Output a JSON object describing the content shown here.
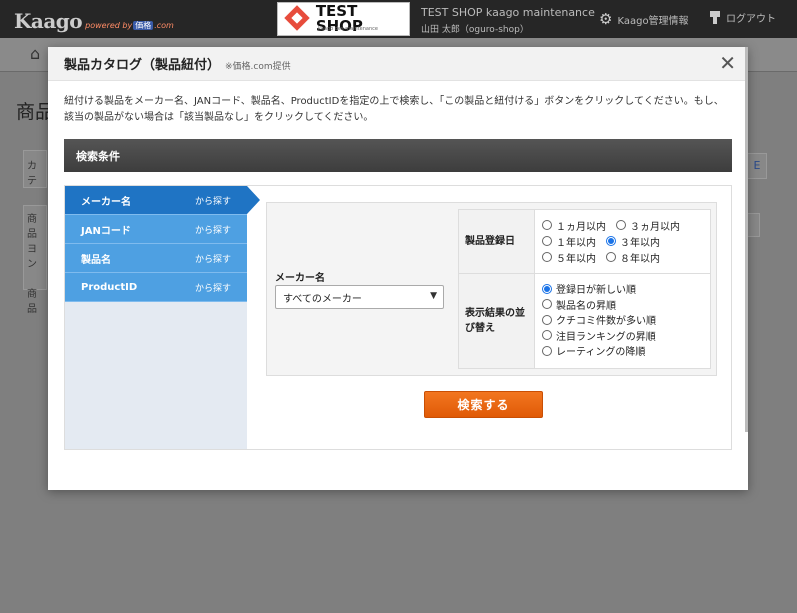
{
  "header": {
    "logo_text": "Kaago",
    "logo_sub_prefix": "powered by",
    "logo_sub_brand": "価格",
    "logo_sub_suffix": ".com",
    "shop_banner_name": "TEST SHOP",
    "shop_banner_tagline": "kaago des maintenance",
    "shop_info_line1": "TEST SHOP kaago maintenance",
    "shop_info_line2": "山田 太郎（oguro-shop）",
    "admin_link": "Kaago管理情報",
    "logout_link": "ログアウト"
  },
  "background": {
    "page_title": "商品",
    "box1": "カテ",
    "box2": "商品ヨン",
    "box3": "商品",
    "right_btn1": "E"
  },
  "modal": {
    "title": "製品カタログ（製品紐付）",
    "title_note": "※価格.com提供",
    "description": "紐付ける製品をメーカー名、JANコード、製品名、ProductIDを指定の上で検索し、「この製品と紐付ける」ボタンをクリックしてください。もし、該当の製品がない場合は「該当製品なし」をクリックしてください。",
    "condition_header": "検索条件",
    "tabs": [
      {
        "label": "メーカー名",
        "suffix": "から探す"
      },
      {
        "label": "JANコード",
        "suffix": "から探す"
      },
      {
        "label": "製品名",
        "suffix": "から探す"
      },
      {
        "label": "ProductID",
        "suffix": "から探す"
      }
    ],
    "maker_label": "メーカー名",
    "maker_select_value": "すべてのメーカー",
    "reg_date_label": "製品登録日",
    "reg_date_options": [
      "１ヵ月以内",
      "３ヵ月以内",
      "１年以内",
      "３年以内",
      "５年以内",
      "８年以内"
    ],
    "reg_date_selected": "３年以内",
    "sort_label": "表示結果の並び替え",
    "sort_options": [
      "登録日が新しい順",
      "製品名の昇順",
      "クチコミ件数が多い順",
      "注目ランキングの昇順",
      "レーティングの降順"
    ],
    "sort_selected": "登録日が新しい順",
    "search_button": "検索する"
  }
}
